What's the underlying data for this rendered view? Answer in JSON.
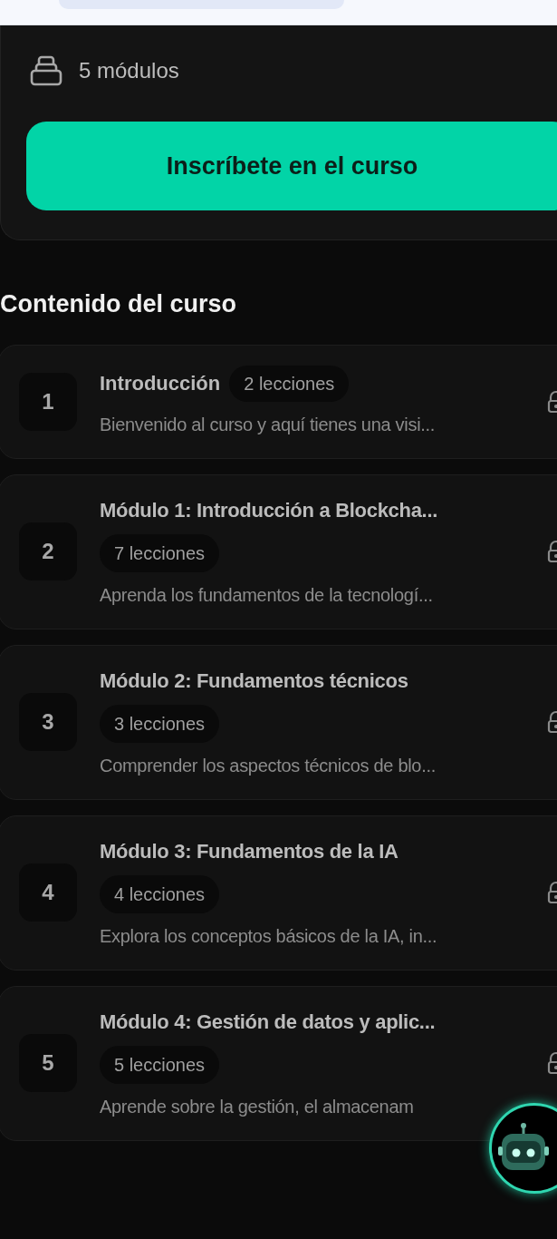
{
  "summary": {
    "modules_count": "5 módulos",
    "enroll_button": "Inscríbete en el curso"
  },
  "content": {
    "title": "Contenido del curso",
    "modules": [
      {
        "number": "1",
        "title": "Introducción",
        "lessons": "2 lecciones",
        "description": "Bienvenido al curso y aquí tienes una visi...",
        "locked": true
      },
      {
        "number": "2",
        "title": "Módulo 1: Introducción a Blockcha...",
        "lessons": "7 lecciones",
        "description": "Aprenda los fundamentos de la tecnologí...",
        "locked": true
      },
      {
        "number": "3",
        "title": "Módulo 2: Fundamentos técnicos",
        "lessons": "3 lecciones",
        "description": "Comprender los aspectos técnicos de blo...",
        "locked": true
      },
      {
        "number": "4",
        "title": "Módulo 3: Fundamentos de la IA",
        "lessons": "4 lecciones",
        "description": "Explora los conceptos básicos de la IA, in...",
        "locked": true
      },
      {
        "number": "5",
        "title": "Módulo 4: Gestión de datos y aplic...",
        "lessons": "5 lecciones",
        "description": "Aprende sobre la gestión, el almacenam",
        "locked": true
      }
    ]
  }
}
